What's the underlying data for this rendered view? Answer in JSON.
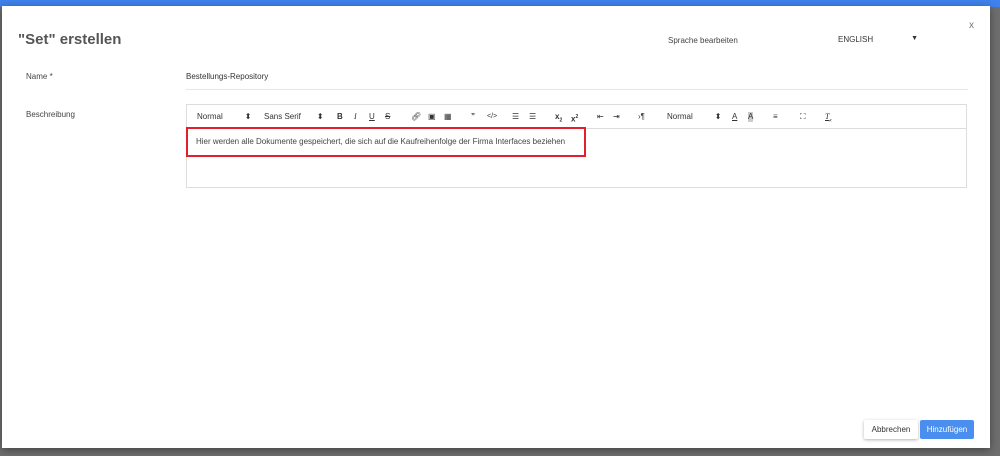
{
  "dialog": {
    "title": "\"Set\" erstellen",
    "close_label": "x",
    "language_label": "Sprache bearbeiten",
    "language_value": "ENGLISH"
  },
  "form": {
    "name_label": "Name *",
    "name_value": "Bestellungs-Repository",
    "description_label": "Beschreibung",
    "description_value": "Hier werden alle Dokumente gespeichert, die sich auf die Kaufreihenfolge der Firma Interfaces beziehen"
  },
  "toolbar": {
    "heading": "Normal",
    "font": "Sans Serif",
    "size": "Normal"
  },
  "buttons": {
    "cancel": "Abbrechen",
    "add": "Hinzufügen"
  }
}
